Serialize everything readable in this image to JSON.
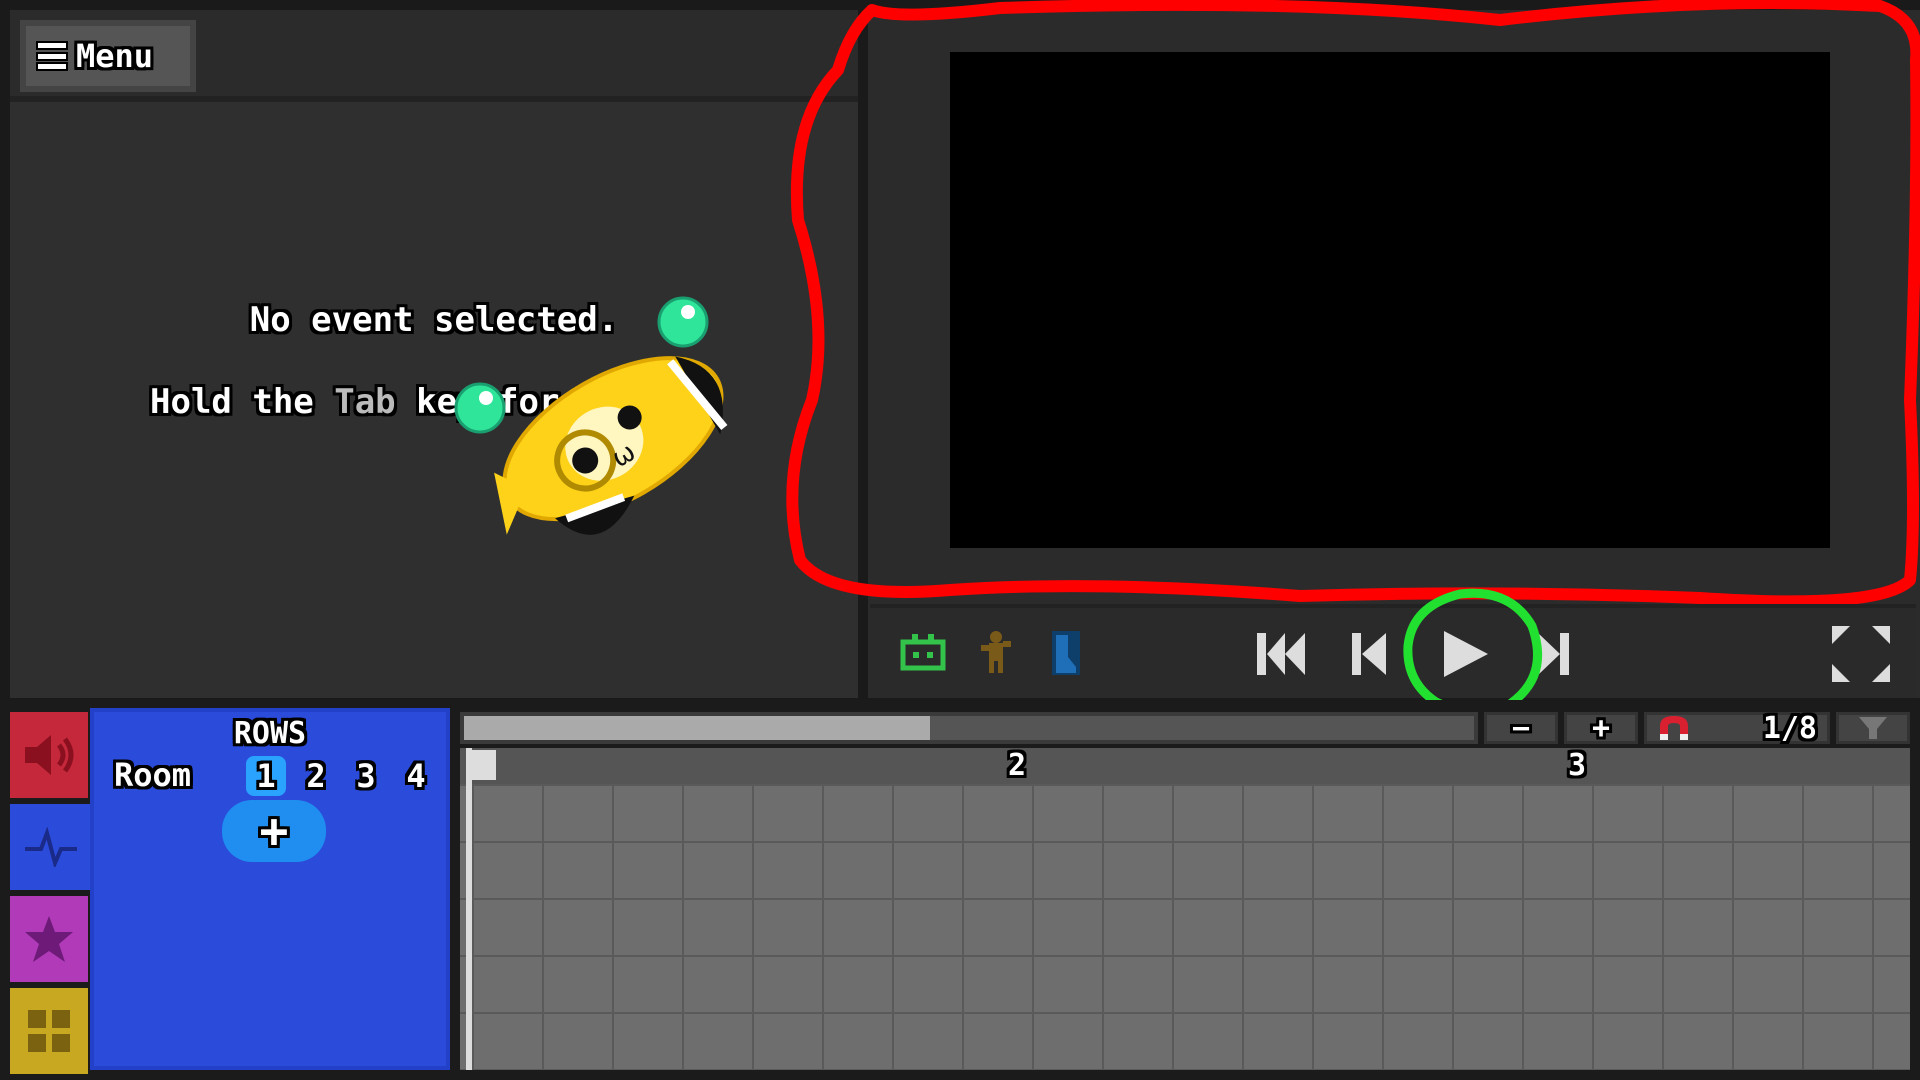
{
  "inspector": {
    "menu_label": "Menu",
    "no_event": "No event selected.",
    "hold_prefix": "Hold the ",
    "hold_key": "Tab",
    "hold_suffix": " key for h"
  },
  "transport": {
    "buttons": [
      "robot-icon",
      "character-icon",
      "bg-icon",
      "skip-to-start",
      "step-back",
      "play",
      "step-forward",
      "fullscreen"
    ]
  },
  "bottom": {
    "rows_title": "ROWS",
    "room_label": "Room",
    "rooms": [
      "1",
      "2",
      "3",
      "4"
    ],
    "selected_room": "1",
    "add_label": "+",
    "snap_label": "1/8",
    "zoom_out_label": "−",
    "zoom_in_label": "+",
    "ruler": [
      "2",
      "3"
    ],
    "tabs": [
      "sound",
      "rows",
      "actions",
      "rooms"
    ]
  },
  "colors": {
    "rows_panel": "#2b4bdb",
    "sound_tab": "#c4283a",
    "actions_tab": "#b03ab8",
    "rooms_tab": "#c8a820",
    "annotation_red": "#ff0000",
    "annotation_green": "#22e030"
  }
}
